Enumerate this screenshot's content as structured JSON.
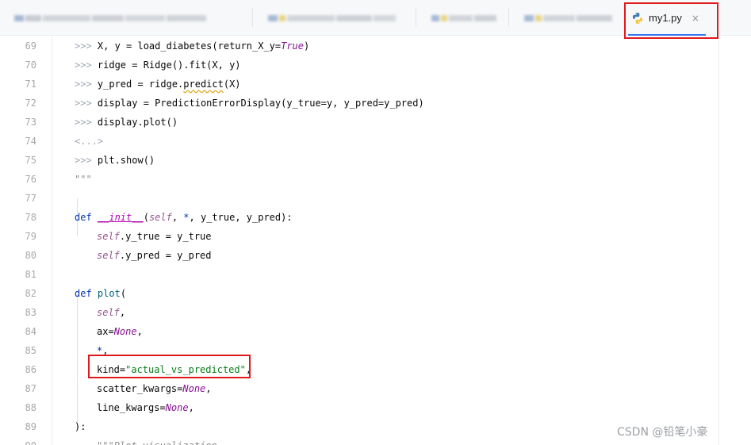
{
  "tabs": [
    {
      "label": "",
      "blurred": true
    },
    {
      "label": "",
      "blurred": true
    },
    {
      "label": "",
      "blurred": true
    },
    {
      "label": "",
      "blurred": true
    },
    {
      "label": "my1.py",
      "blurred": false,
      "active": true,
      "icon": "python-icon",
      "close": "×"
    }
  ],
  "colors": {
    "accent": "#3574f0",
    "highlight_box": "#e0191b",
    "keyword": "#0033b3",
    "string": "#067d17",
    "self": "#94558d",
    "keyword_value": "#871094"
  },
  "code": {
    "lines": [
      {
        "num": "69",
        "parts": [
          [
            "dp",
            ">>> "
          ],
          [
            "",
            "X, y = load_diabetes(return_X_y="
          ],
          [
            "kwv",
            "True"
          ],
          [
            "",
            ")"
          ]
        ]
      },
      {
        "num": "70",
        "parts": [
          [
            "dp",
            ">>> "
          ],
          [
            "",
            "ridge = Ridge().fit(X, y)"
          ]
        ]
      },
      {
        "num": "71",
        "parts": [
          [
            "dp",
            ">>> "
          ],
          [
            "",
            "y_pred = ridge."
          ],
          [
            "squig",
            "predict"
          ],
          [
            "",
            "(X)"
          ]
        ]
      },
      {
        "num": "72",
        "parts": [
          [
            "dp",
            ">>> "
          ],
          [
            "",
            "display = PredictionErrorDisplay(y_true=y, y_pred=y_pred)"
          ]
        ]
      },
      {
        "num": "73",
        "parts": [
          [
            "dp",
            ">>> "
          ],
          [
            "",
            "display.plot()"
          ]
        ]
      },
      {
        "num": "74",
        "parts": [
          [
            "dp",
            "<...>"
          ]
        ]
      },
      {
        "num": "75",
        "parts": [
          [
            "dp",
            ">>> "
          ],
          [
            "",
            "plt.show()"
          ]
        ]
      },
      {
        "num": "76",
        "parts": [
          [
            "doc",
            "\"\"\""
          ]
        ]
      },
      {
        "num": "77",
        "parts": []
      },
      {
        "num": "78",
        "parts": [
          [
            "kw",
            "def "
          ],
          [
            "magic",
            "__init__"
          ],
          [
            "",
            "("
          ],
          [
            "self",
            "self"
          ],
          [
            "",
            ", "
          ],
          [
            "kw",
            "*"
          ],
          [
            "",
            ", y_true, y_pred):"
          ]
        ]
      },
      {
        "num": "79",
        "parts": [
          [
            "self",
            "self"
          ],
          [
            "",
            ".y_true = y_true"
          ]
        ]
      },
      {
        "num": "80",
        "parts": [
          [
            "self",
            "self"
          ],
          [
            "",
            ".y_pred = y_pred"
          ]
        ]
      },
      {
        "num": "81",
        "parts": []
      },
      {
        "num": "82",
        "parts": [
          [
            "kw",
            "def "
          ],
          [
            "fn",
            "plot"
          ],
          [
            "",
            "("
          ]
        ]
      },
      {
        "num": "83",
        "parts": [
          [
            "self",
            "self"
          ],
          [
            "",
            ","
          ]
        ]
      },
      {
        "num": "84",
        "parts": [
          [
            "",
            "ax="
          ],
          [
            "kwv",
            "None"
          ],
          [
            "",
            ","
          ]
        ]
      },
      {
        "num": "85",
        "parts": [
          [
            "kw",
            "*"
          ],
          [
            "",
            ","
          ]
        ]
      },
      {
        "num": "86",
        "parts": [
          [
            "",
            "kind="
          ],
          [
            "str",
            "\"actual_vs_predicted\""
          ],
          [
            "",
            ","
          ]
        ]
      },
      {
        "num": "87",
        "parts": [
          [
            "",
            "scatter_kwargs="
          ],
          [
            "kwv",
            "None"
          ],
          [
            "",
            ","
          ]
        ]
      },
      {
        "num": "88",
        "parts": [
          [
            "",
            "line_kwargs="
          ],
          [
            "kwv",
            "None"
          ],
          [
            "",
            ","
          ]
        ]
      },
      {
        "num": "89",
        "parts": [
          [
            "",
            "):"
          ]
        ]
      },
      {
        "num": "90",
        "parts": [
          [
            "doc",
            "\"\"\"Plot visualization"
          ]
        ]
      }
    ]
  },
  "watermark": "CSDN @铅笔小豪"
}
